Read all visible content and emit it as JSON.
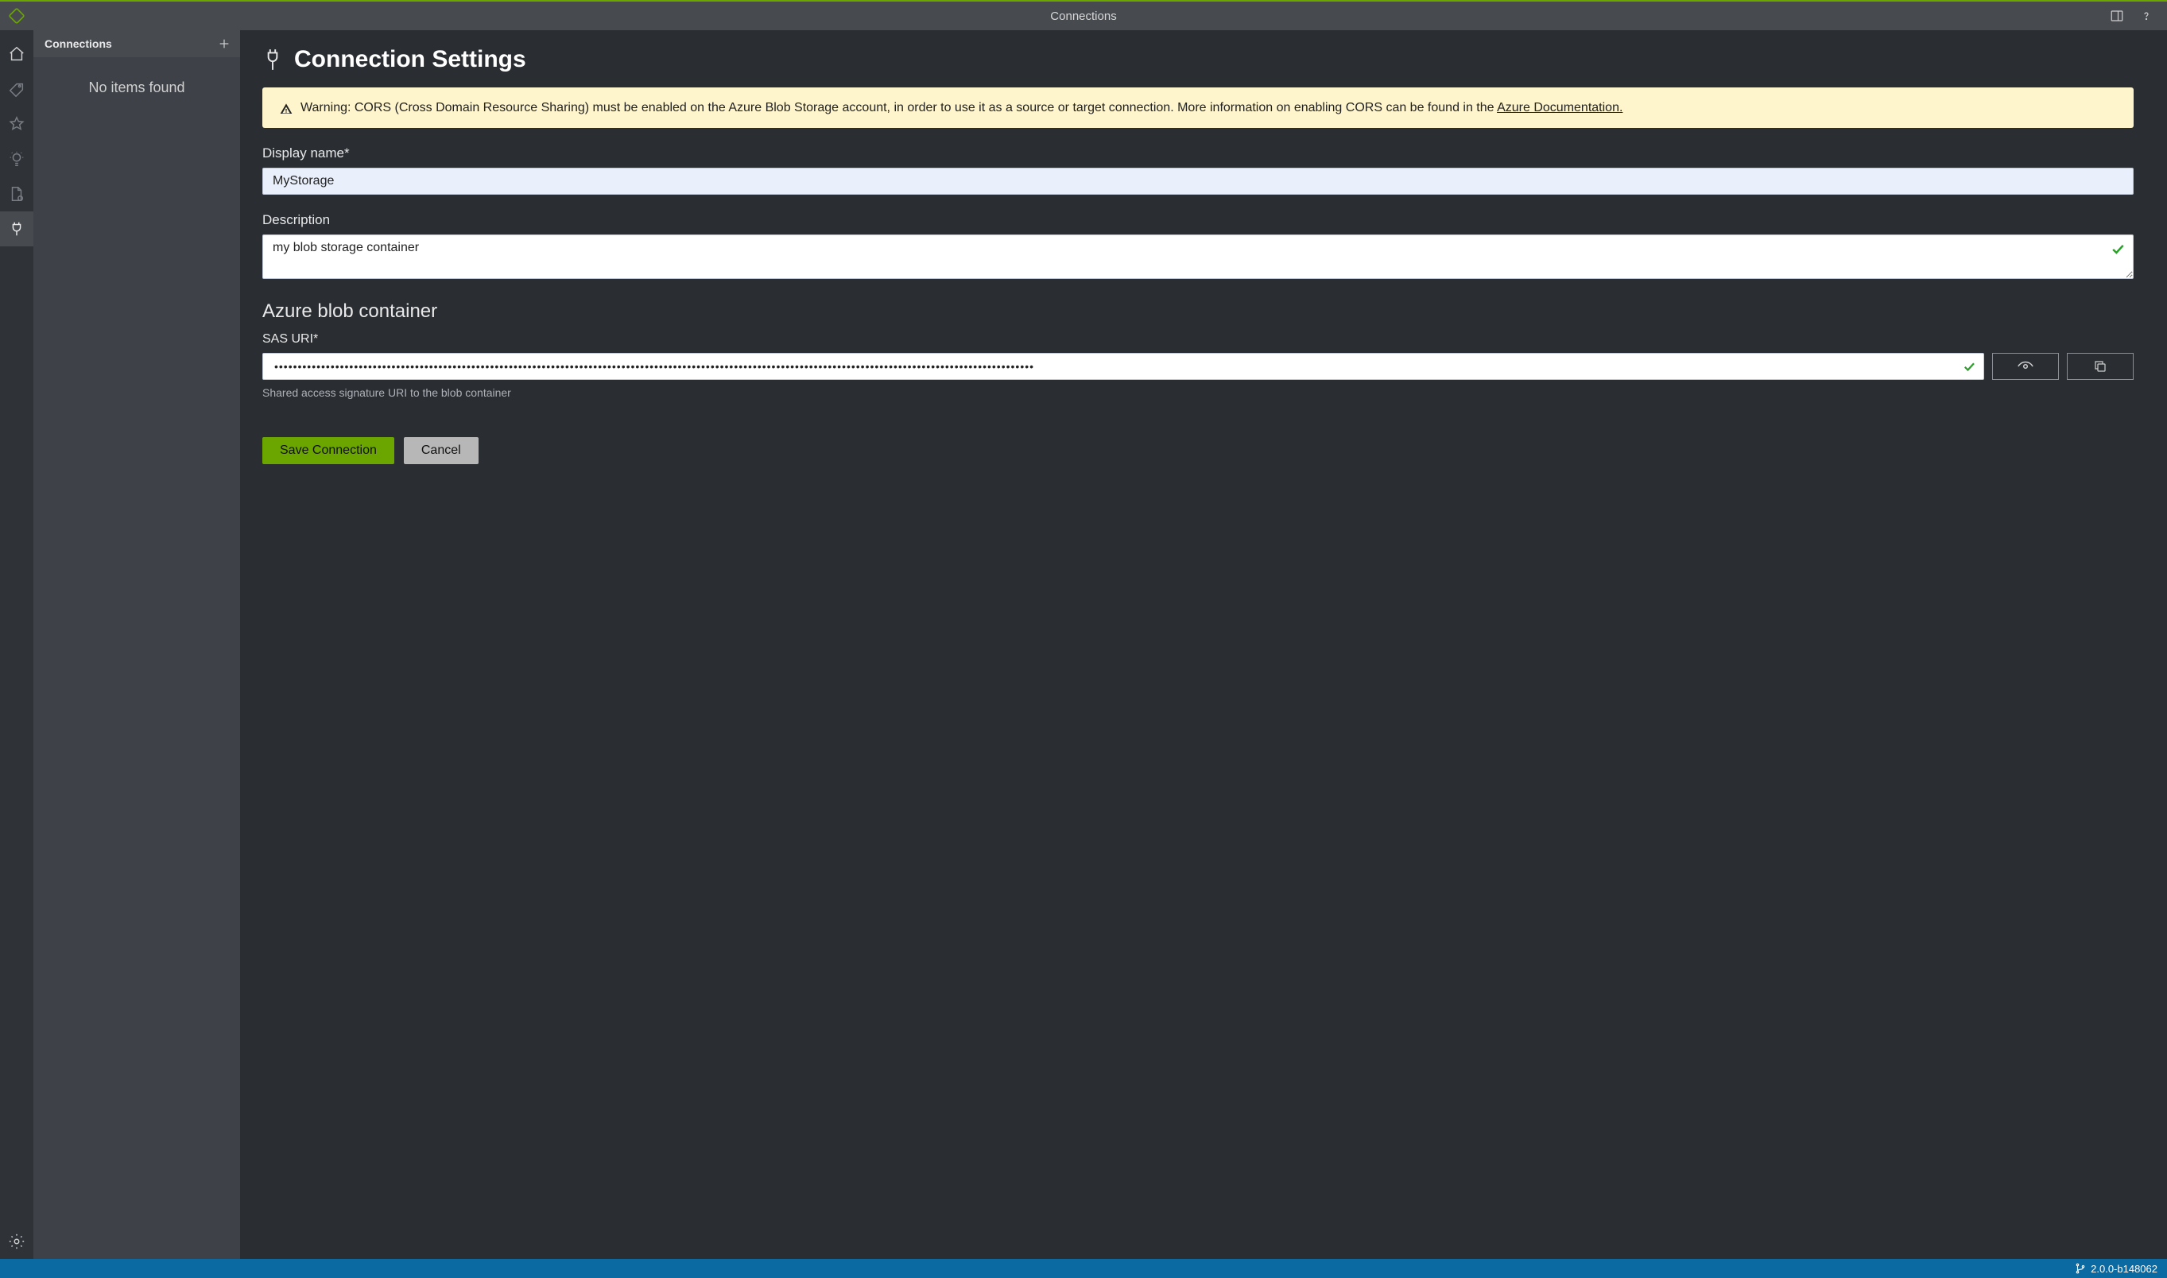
{
  "title_bar": {
    "title": "Connections"
  },
  "side_panel": {
    "title": "Connections",
    "empty": "No items found"
  },
  "page": {
    "heading": "Connection Settings",
    "alert_prefix": "Warning: CORS (Cross Domain Resource Sharing) must be enabled on the Azure Blob Storage account, in order to use it as a source or target connection. More information on enabling CORS can be found in the ",
    "alert_link": "Azure Documentation."
  },
  "fields": {
    "display_name_label": "Display name*",
    "display_name_value": "MyStorage",
    "description_label": "Description",
    "description_value": "my blob storage container",
    "section_heading": "Azure blob container",
    "sas_label": "SAS URI*",
    "sas_value": "••••••••••••••••••••••••••••••••••••••••••••••••••••••••••••••••••••••••••••••••••••••••••••••••••••••••••••••••••••••••••••••••••••••••••••••••••••••••••••••••••",
    "sas_helper": "Shared access signature URI to the blob container"
  },
  "buttons": {
    "save": "Save Connection",
    "cancel": "Cancel"
  },
  "status": {
    "version": "2.0.0-b148062"
  },
  "colors": {
    "accent": "#6aa500",
    "status_bar": "#0a6aa1",
    "alert_bg": "#fff5cc"
  }
}
